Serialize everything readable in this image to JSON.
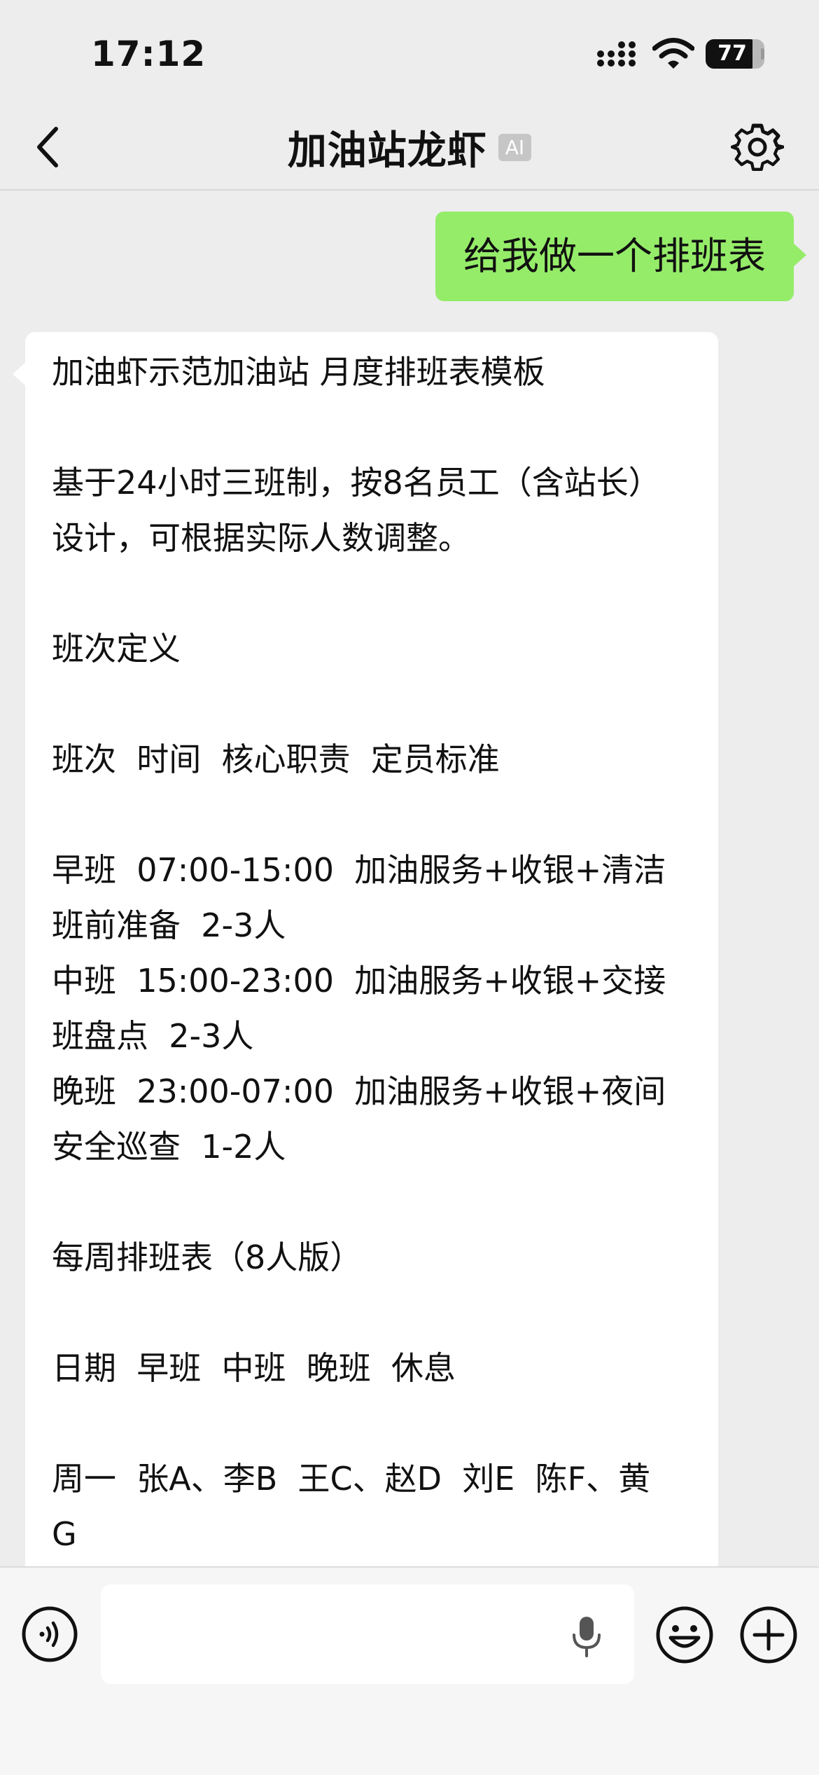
{
  "status_bar": {
    "time": "17:12",
    "battery": "77",
    "battery_level": 0.77
  },
  "nav": {
    "title": "加油站龙虾",
    "badge": "AI",
    "icons": [
      "back-icon",
      "gear-icon"
    ]
  },
  "chat": {
    "user_message": "给我做一个排班表",
    "bot_message_lines": [
      "加油虾示范加油站 月度排班表模板",
      "",
      "基于24小时三班制，按8名员工（含站长）",
      "设计，可根据实际人数调整。",
      "",
      "班次定义",
      "",
      "班次  时间  核心职责  定员标准",
      "",
      "早班  07:00-15:00  加油服务+收银+清洁",
      "班前准备  2-3人",
      "中班  15:00-23:00  加油服务+收银+交接",
      "班盘点  2-3人",
      "晚班  23:00-07:00  加油服务+收银+夜间",
      "安全巡查  1-2人",
      "",
      "每周排班表（8人版）",
      "",
      "日期  早班  中班  晚班  休息",
      "",
      "周一  张A、李B  王C、赵D  刘E  陈F、黄",
      "G"
    ]
  },
  "input_bar": {
    "placeholder": "",
    "icons": [
      "voice-icon",
      "microphone-icon",
      "emoji-icon",
      "plus-icon"
    ]
  }
}
